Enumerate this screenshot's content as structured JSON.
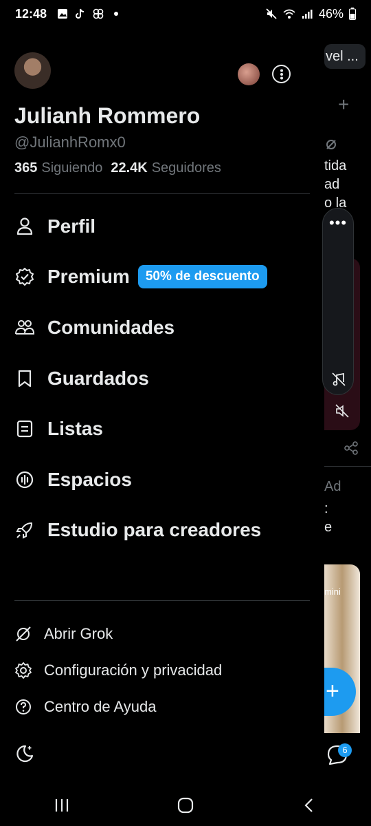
{
  "status_bar": {
    "time": "12:48",
    "battery": "46%",
    "left_icons": [
      "gallery-icon",
      "tiktok-icon",
      "pinwheel-icon",
      "dot-icon"
    ],
    "right_icons": [
      "mute-icon",
      "wifi-icon",
      "signal-icon",
      "battery-icon"
    ]
  },
  "profile": {
    "name": "Julianh Rommero",
    "handle": "@JulianhRomx0",
    "following_count": "365",
    "following_label": "Siguiendo",
    "followers_count": "22.4K",
    "followers_label": "Seguidores"
  },
  "menu": {
    "items": [
      {
        "label": "Perfil",
        "icon": "person-icon"
      },
      {
        "label": "Premium",
        "icon": "verified-badge-icon",
        "badge": "50% de descuento"
      },
      {
        "label": "Comunidades",
        "icon": "communities-icon"
      },
      {
        "label": "Guardados",
        "icon": "bookmark-icon"
      },
      {
        "label": "Listas",
        "icon": "list-icon"
      },
      {
        "label": "Espacios",
        "icon": "spaces-icon"
      },
      {
        "label": "Estudio para creadores",
        "icon": "rocket-icon"
      }
    ]
  },
  "secondary_menu": {
    "items": [
      {
        "label": "Abrir Grok",
        "icon": "grok-icon"
      },
      {
        "label": "Configuración y privacidad",
        "icon": "gear-icon"
      },
      {
        "label": "Centro de Ayuda",
        "icon": "help-icon"
      }
    ]
  },
  "feed_background": {
    "pill_text": "vel ...",
    "snippets": [
      "tida",
      "ad",
      "o la"
    ],
    "ad_label": "Ad",
    "snip2": [
      ":",
      "e"
    ],
    "card_text": "mini",
    "chat_badge_count": "6"
  },
  "colors": {
    "accent": "#1d9bf0",
    "background": "#000000",
    "primary_text": "#e7e9ea",
    "secondary_text": "#71767b"
  }
}
